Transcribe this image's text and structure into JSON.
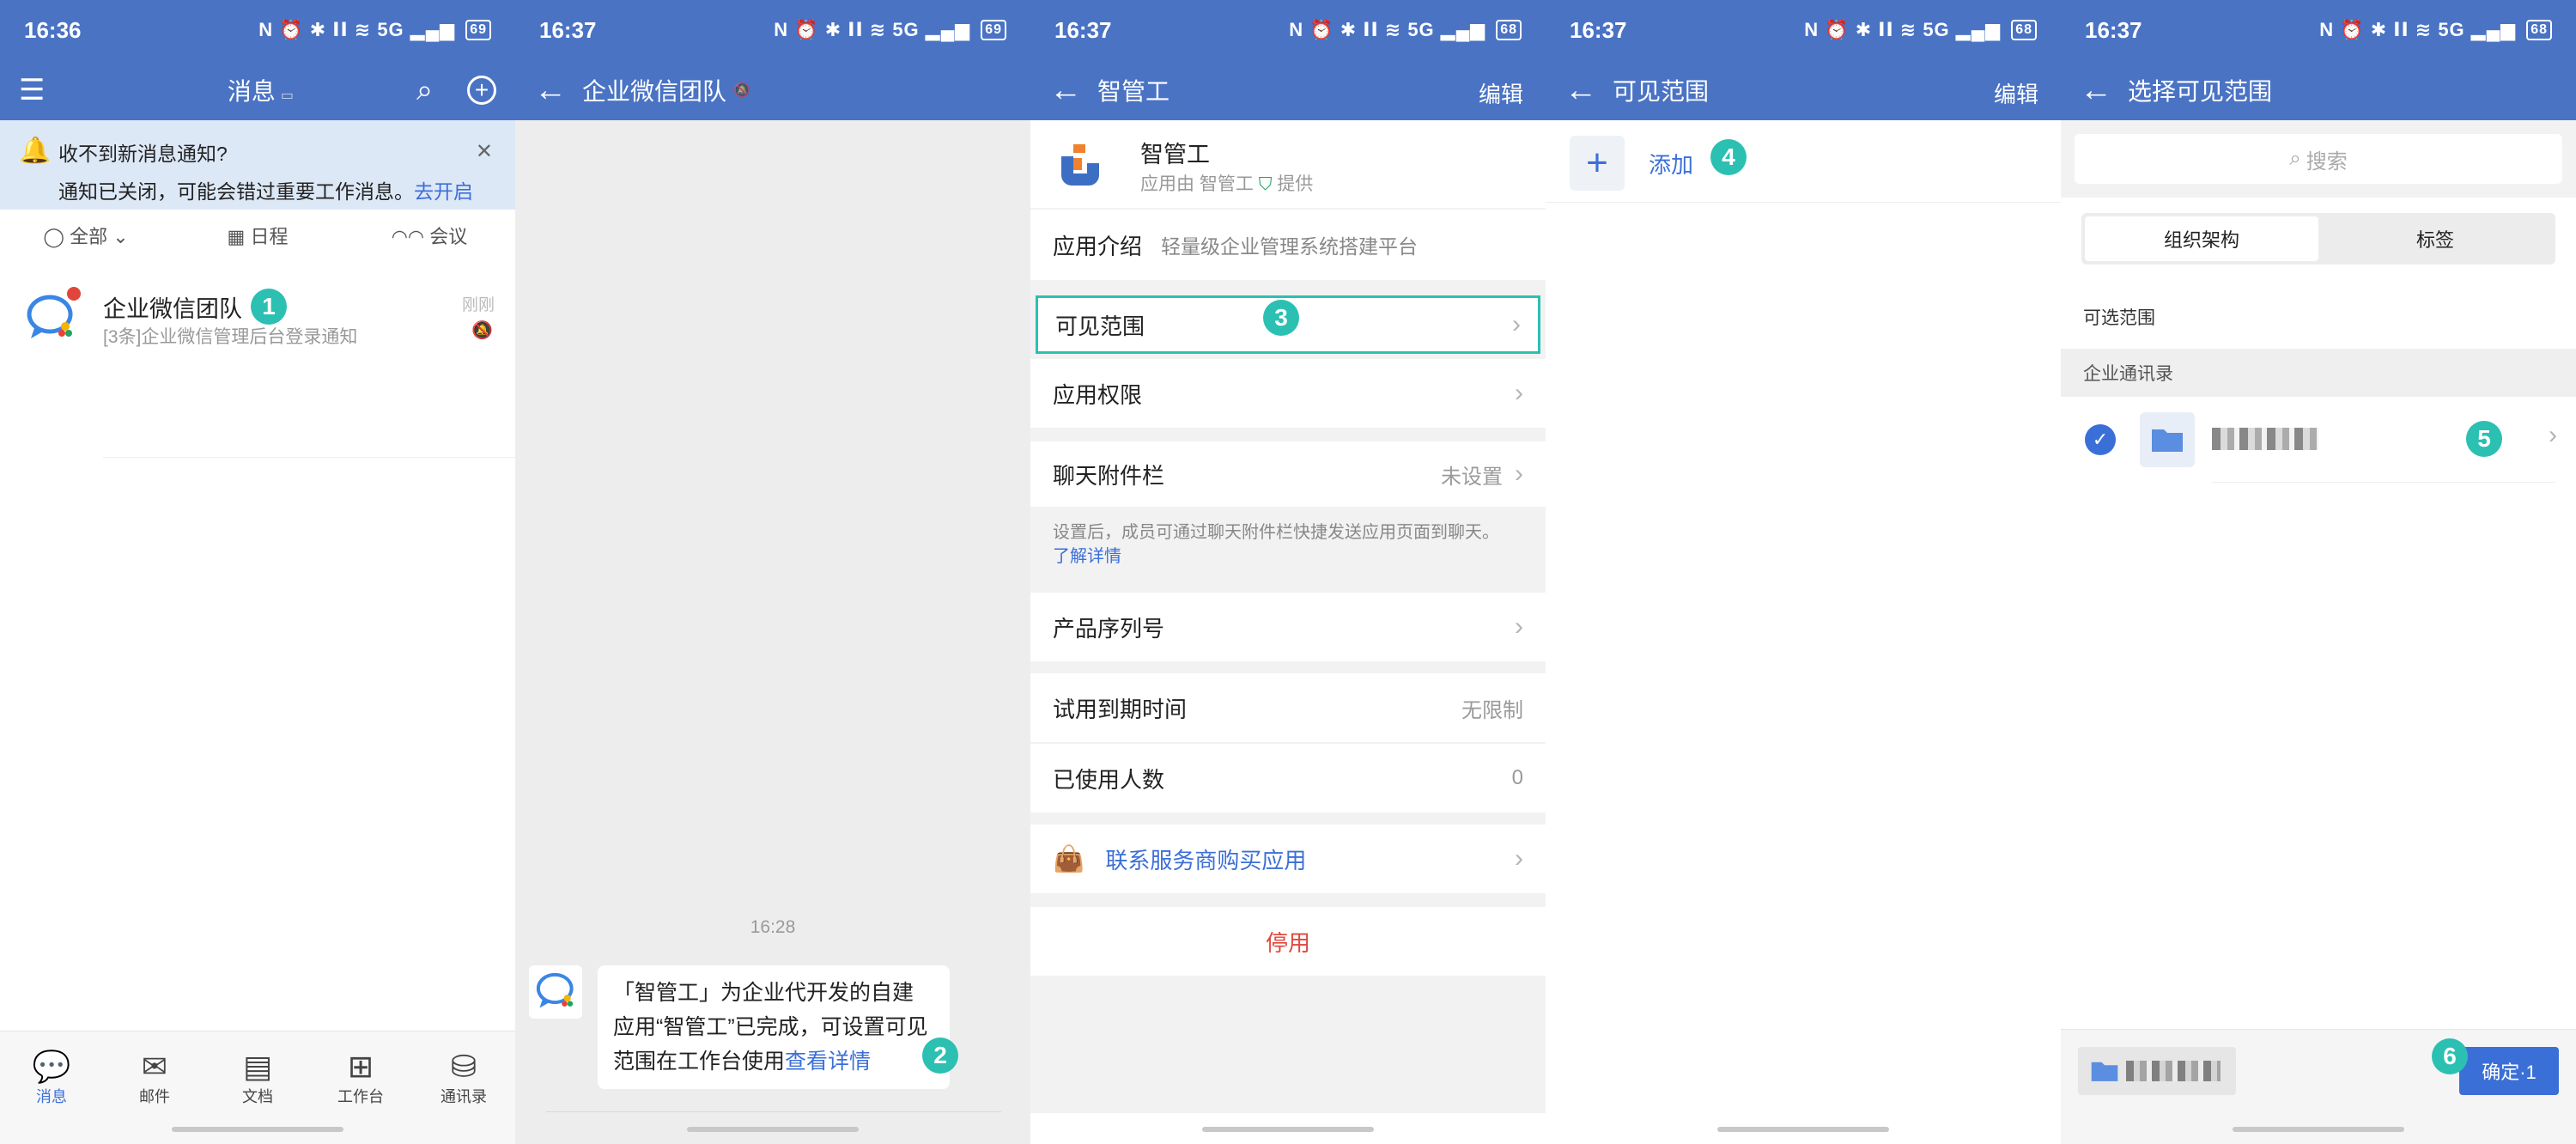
{
  "status": [
    {
      "time": "16:36",
      "icons": "N ⏰ ✱ ⅠⅠ ≋ 5G ▂▄▆",
      "battery": "69"
    },
    {
      "time": "16:37",
      "icons": "N ⏰ ✱ ⅠⅠ ≋ 5G ▂▄▆",
      "battery": "69"
    },
    {
      "time": "16:37",
      "icons": "N ⏰ ✱ ⅠⅠ ≋ 5G ▂▄▆",
      "battery": "68"
    },
    {
      "time": "16:37",
      "icons": "N ⏰ ✱ ⅠⅠ ≋ 5G ▂▄▆",
      "battery": "68"
    },
    {
      "time": "16:37",
      "icons": "N ⏰ ✱ ⅠⅠ ≋ 5G ▂▄▆",
      "battery": "68"
    }
  ],
  "p1": {
    "title": "消息",
    "notice_title": "收不到新消息通知?",
    "notice_body": "通知已关闭，可能会错过重要工作消息。",
    "notice_link": "去开启",
    "filters": [
      "全部",
      "日程",
      "会议"
    ],
    "chat": {
      "name": "企业微信团队",
      "preview": "[3条]企业微信管理后台登录通知",
      "time": "刚刚",
      "badge": "1"
    },
    "tabs": [
      "消息",
      "邮件",
      "文档",
      "工作台",
      "通讯录"
    ]
  },
  "p2": {
    "title": "企业微信团队",
    "time": "16:28",
    "msg_text": "「智管工」为企业代开发的自建应用“智管工”已完成，可设置可见范围在工作台使用",
    "msg_link": "查看详情",
    "badge": "2"
  },
  "p3": {
    "title": "智管工",
    "edit": "编辑",
    "app_name": "智管工",
    "app_sub": "应用由 智管工",
    "app_sub2": "提供",
    "intro_label": "应用介绍",
    "intro_text": "轻量级企业管理系统搭建平台",
    "visible": "可见范围",
    "badge": "3",
    "permission": "应用权限",
    "attach": "聊天附件栏",
    "attach_val": "未设置",
    "attach_note": "设置后，成员可通过聊天附件栏快捷发送应用页面到聊天。",
    "attach_link": "了解详情",
    "serial": "产品序列号",
    "trial": "试用到期时间",
    "trial_val": "无限制",
    "used": "已使用人数",
    "used_val": "0",
    "contact": "联系服务商购买应用",
    "disable": "停用"
  },
  "p4": {
    "title": "可见范围",
    "edit": "编辑",
    "add": "添加",
    "badge": "4"
  },
  "p5": {
    "title": "选择可见范围",
    "search": "搜索",
    "seg": [
      "组织架构",
      "标签"
    ],
    "optional": "可选范围",
    "section": "企业通讯录",
    "badge5": "5",
    "badge6": "6",
    "confirm": "确定·1"
  },
  "colors": {
    "header": "#4a73c4",
    "accent": "#3b6fd8",
    "teal": "#2bc0b2",
    "red": "#e0463b"
  }
}
